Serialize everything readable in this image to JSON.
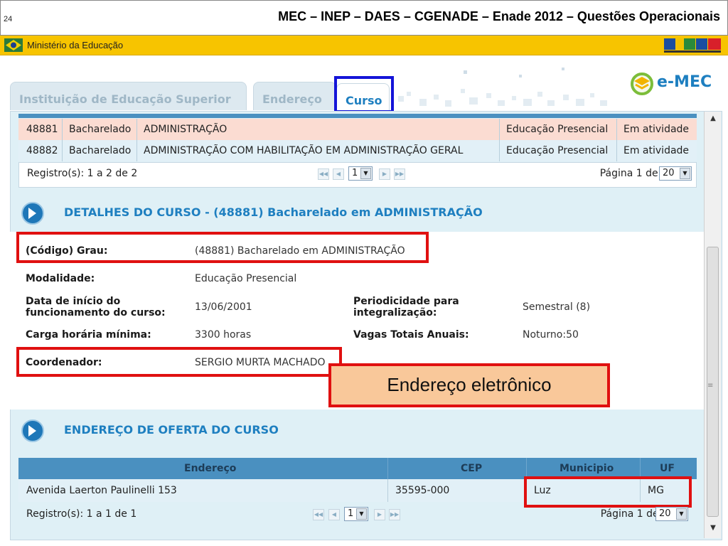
{
  "slide": {
    "number": "24",
    "title": "MEC – INEP – DAES – CGENADE – Enade 2012 – Questões Operacionais"
  },
  "ministry_bar": {
    "label": "Ministério da Educação"
  },
  "tabs": [
    {
      "label": "Instituição de Educação Superior",
      "active": false
    },
    {
      "label": "Endereço",
      "active": false
    },
    {
      "label": "Curso",
      "active": true
    }
  ],
  "logo": {
    "text": "e-MEC"
  },
  "courses_table": {
    "rows": [
      {
        "code": "48881",
        "grau": "Bacharelado",
        "nome": "ADMINISTRAÇÃO",
        "modalidade": "Educação Presencial",
        "situacao": "Em atividade"
      },
      {
        "code": "48882",
        "grau": "Bacharelado",
        "nome": "ADMINISTRAÇÃO COM HABILITAÇÃO EM ADMINISTRAÇÃO GERAL",
        "modalidade": "Educação Presencial",
        "situacao": "Em atividade"
      }
    ],
    "pager": {
      "registros": "Registro(s): 1 a 2 de 2",
      "page_select": "1",
      "pagina": "Página 1 de 1",
      "per_page": "20"
    }
  },
  "details": {
    "section_title": "DETALHES DO CURSO - (48881) Bacharelado em ADMINISTRAÇÃO",
    "codigo_grau_label": "(Código) Grau:",
    "codigo_grau_value": "(48881) Bacharelado em ADMINISTRAÇÃO",
    "modalidade_label": "Modalidade:",
    "modalidade_value": "Educação Presencial",
    "inicio_label_1": "Data de início do",
    "inicio_label_2": "funcionamento do curso:",
    "inicio_value": "13/06/2001",
    "periodicidade_label_1": "Periodicidade para",
    "periodicidade_label_2": "integralização:",
    "periodicidade_value": "Semestral (8)",
    "carga_label": "Carga horária mínima:",
    "carga_value": "3300 horas",
    "vagas_label": "Vagas Totais Anuais:",
    "vagas_value": "Noturno:50",
    "coordenador_label": "Coordenador:",
    "coordenador_value": "SERGIO MURTA MACHADO"
  },
  "callout": {
    "text": "Endereço eletrônico"
  },
  "address": {
    "section_title": "ENDEREÇO DE OFERTA DO CURSO",
    "headers": {
      "endereco": "Endereço",
      "cep": "CEP",
      "municipio": "Municipio",
      "uf": "UF"
    },
    "row": {
      "endereco": "Avenida Laerton Paulinelli 153",
      "cep": "35595-000",
      "municipio": "Luz",
      "uf": "MG"
    },
    "pager": {
      "registros": "Registro(s): 1 a 1 de 1",
      "page_select": "1",
      "pagina": "Página 1 de 1",
      "per_page": "20"
    }
  },
  "colors": {
    "accent": "#1e7fc0",
    "header_bar": "#f7c400",
    "highlight_red": "#e01010",
    "highlight_blue": "#1414d8"
  }
}
